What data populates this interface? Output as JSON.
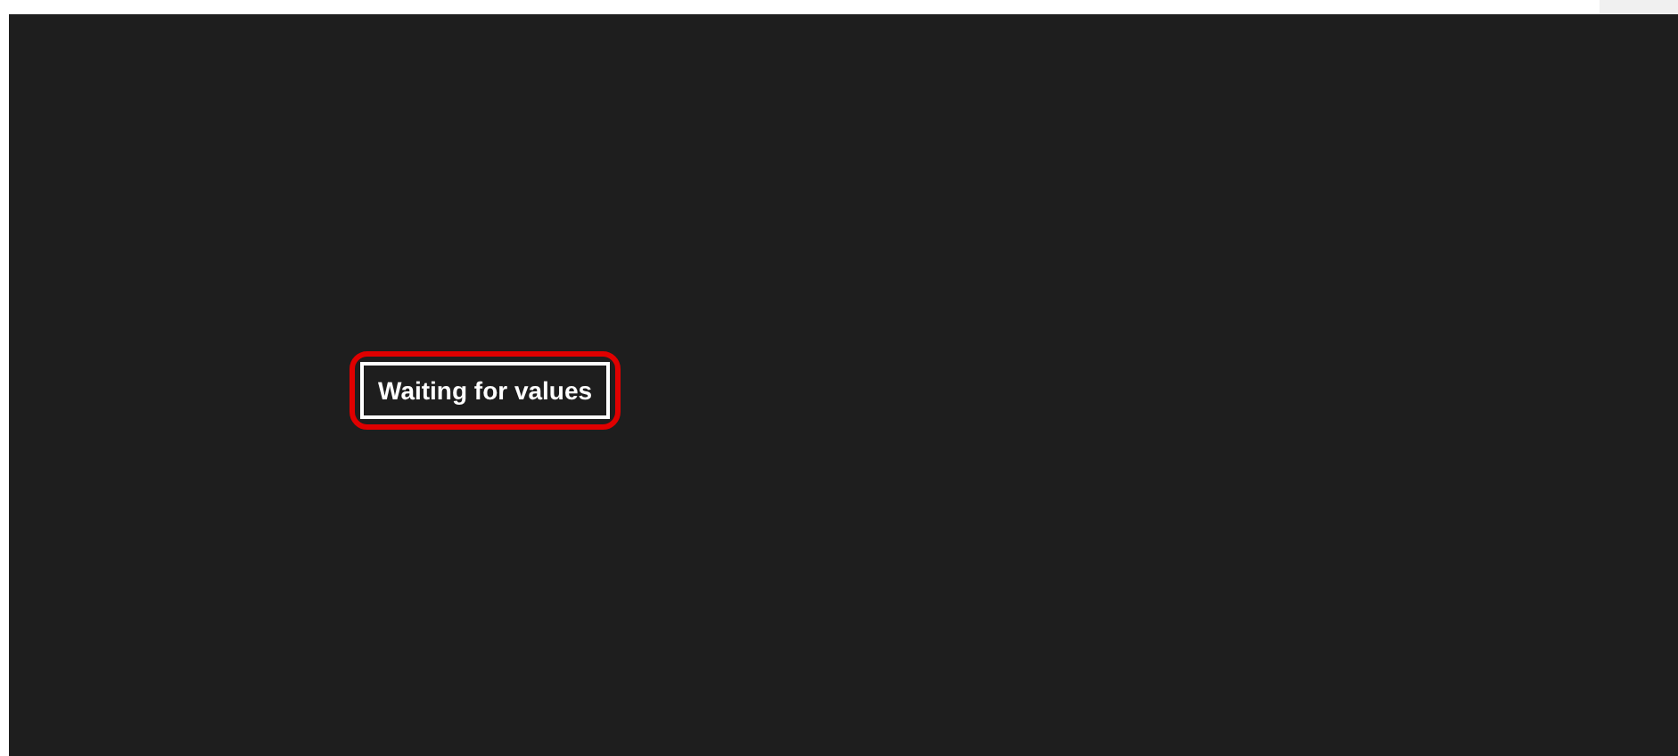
{
  "status": {
    "text": "Waiting for values",
    "highlighted": true
  }
}
